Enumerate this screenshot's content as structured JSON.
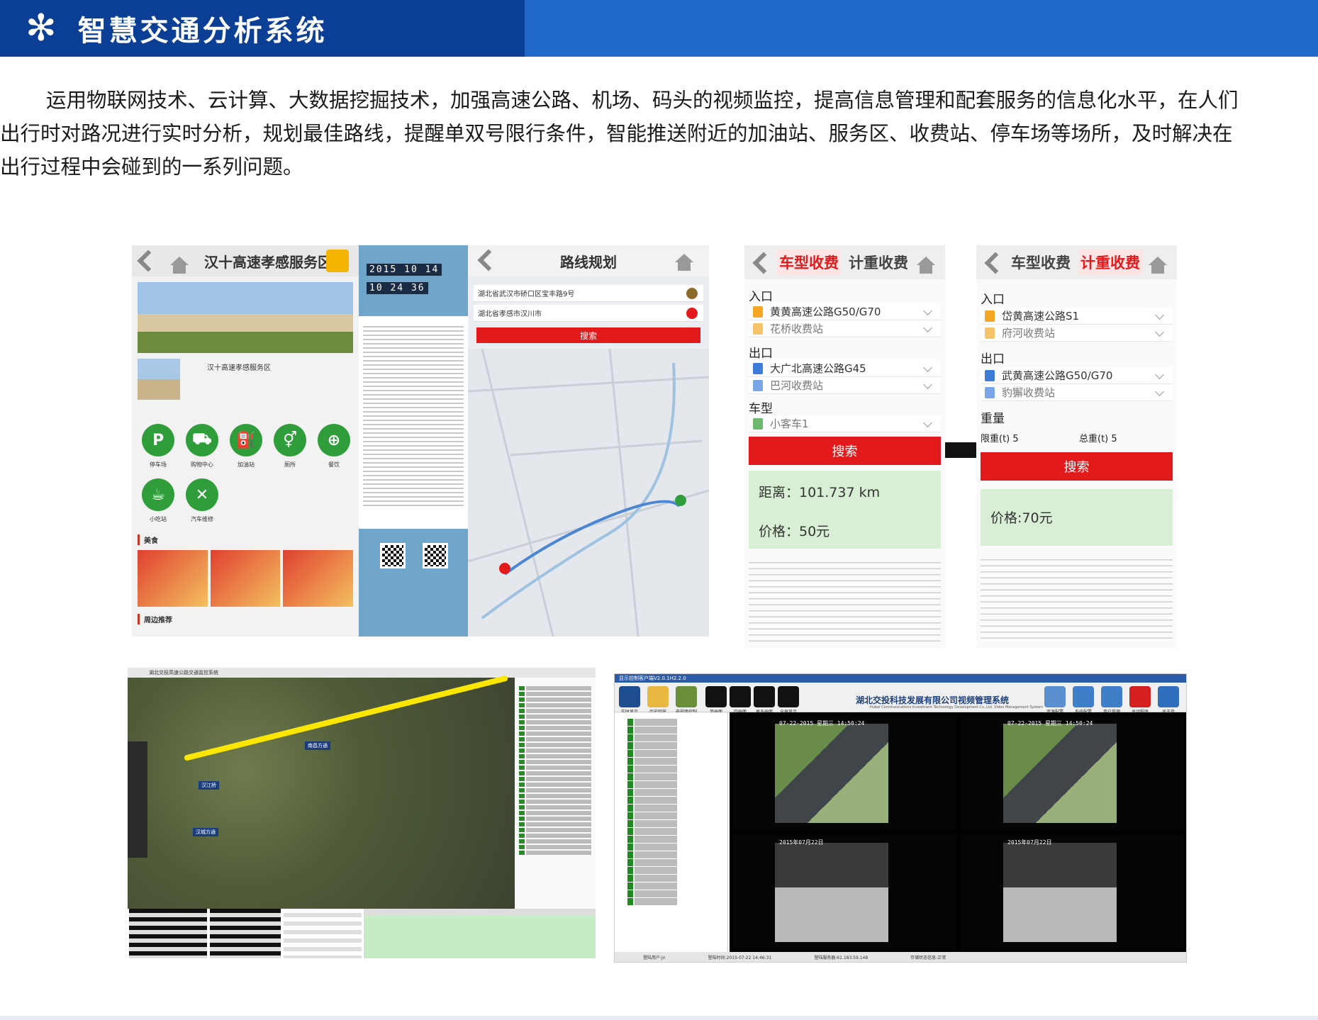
{
  "header": {
    "icon": "asterisk-icon",
    "title": "智慧交通分析系统",
    "colors": {
      "dark": "#0b3f96",
      "light": "#1f68c8"
    }
  },
  "intro": {
    "line1": "运用物联网技术、云计算、大数据挖掘技术，加强高速公路、机场、码头的视频监控，提高信息管理和配套服务的信息化水平，在人们",
    "line2": "出行时对路况进行实时分析，规划最佳路线，提醒单双号限行条件，智能推送附近的加油站、服务区、收费站、停车场等场所，及时解决在",
    "line3": "出行过程中会碰到的一系列问题。"
  },
  "service_area": {
    "title": "汉十高速孝感服务区",
    "thumb_title": "汉十高速孝感服务区",
    "services": [
      {
        "label": "停车场",
        "glyph": "P",
        "icon": "parking-icon"
      },
      {
        "label": "购物中心",
        "glyph": "⛟",
        "icon": "cart-icon"
      },
      {
        "label": "加油站",
        "glyph": "⛽",
        "icon": "fuel-icon"
      },
      {
        "label": "厕所",
        "glyph": "⚥",
        "icon": "restroom-icon"
      },
      {
        "label": "餐饮",
        "glyph": "⊕",
        "icon": "dining-icon"
      },
      {
        "label": "小吃站",
        "glyph": "☕",
        "icon": "snack-icon"
      },
      {
        "label": "汽车维修",
        "glyph": "✕",
        "icon": "repair-icon"
      }
    ],
    "section_food": "美食",
    "section_nearby": "周边推荐"
  },
  "news": {
    "clock_date": "2015 10 14",
    "clock_time": "10 24 36"
  },
  "route": {
    "title": "路线规划",
    "from": "湖北省武汉市硚口区宝丰路9号",
    "to": "湖北省孝感市汉川市",
    "search": "搜索"
  },
  "fee_by_type": {
    "tab_type": "车型收费",
    "tab_weight": "计重收费",
    "entry_label": "入口",
    "entry_road": "黄黄高速公路G50/G70",
    "entry_station": "花桥收费站",
    "exit_label": "出口",
    "exit_road": "大广北高速公路G45",
    "exit_station": "巴河收费站",
    "vehicle_label": "车型",
    "vehicle": "小客车1",
    "search": "搜索",
    "distance": "距离：101.737 km",
    "price": "价格：50元"
  },
  "fee_by_weight": {
    "tab_type": "车型收费",
    "tab_weight": "计重收费",
    "entry_label": "入口",
    "entry_road": "岱黄高速公路S1",
    "entry_station": "府河收费站",
    "exit_label": "出口",
    "exit_road": "武黄高速公路G50/G70",
    "exit_station": "豹獬收费站",
    "weight_label": "重量",
    "limit": "限重(t) 5",
    "total": "总重(t) 5",
    "search": "搜索",
    "price": "价格:70元"
  },
  "monitor": {
    "title": "湖北交投高速公路交通监控系统",
    "road_tags": [
      "南昌方通",
      "汉江桥",
      "汉城方通"
    ]
  },
  "video": {
    "titlebar": "显示控制客户端V2.0.1H2.2.0",
    "brand": "湖北交投科技发展有限公司视频管理系统",
    "brand_en": "Hubei Communications Investment Technology Development Co.,Ltd. Video Management System",
    "tools": [
      "实时显示",
      "历史回放",
      "电视墙控制",
      "单画面",
      "四画面",
      "更多画面",
      "全屏显示"
    ],
    "tools_right": [
      "资源配置",
      "系统配置",
      "用户管理",
      "关闭程序",
      "关于我"
    ],
    "cams": [
      {
        "ts": "07-22-2015 星期三 14:50:24",
        "kind": "road"
      },
      {
        "ts": "07-22-2015 星期三 14:50:24",
        "kind": "road"
      },
      {
        "ts": "2015年07月22日",
        "kind": "room"
      },
      {
        "ts": "2015年07月22日",
        "kind": "room"
      }
    ],
    "status_user": "登陆用户:jn",
    "status_time": "登陆时间:2015-07-22 14:46:31",
    "status_server": "登陆服务器:61.183.59.148",
    "status_state": "存储状态信息:正常"
  }
}
